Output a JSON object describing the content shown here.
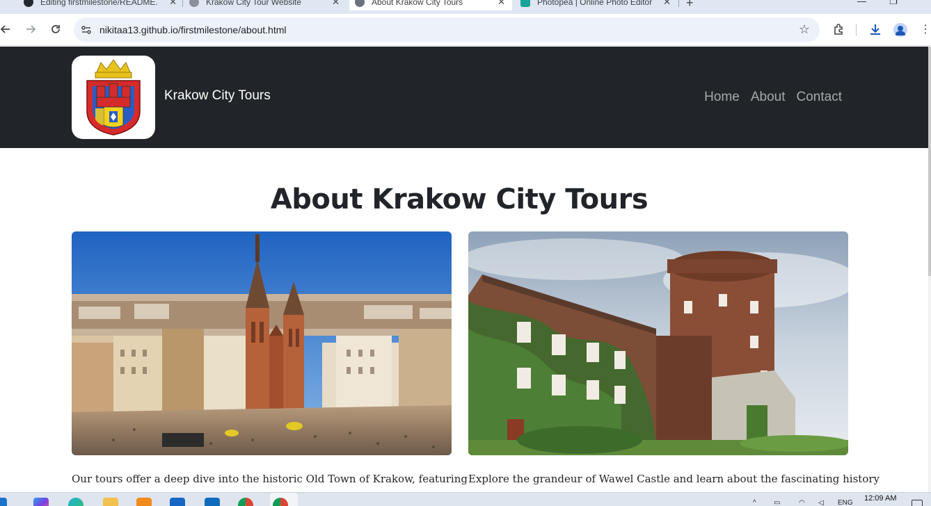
{
  "browser": {
    "tabs": [
      {
        "title": "Editing firstmilestone/README.",
        "active": false
      },
      {
        "title": "Krakow City Tour Website",
        "active": false
      },
      {
        "title": "About Krakow City Tours",
        "active": true
      },
      {
        "title": "Photopea | Online Photo Editor",
        "active": false
      }
    ],
    "new_tab_label": "+",
    "url": "nikitaa13.github.io/firstmilestone/about.html"
  },
  "site": {
    "brand": "Krakow City Tours",
    "nav": [
      {
        "label": "Home"
      },
      {
        "label": "About"
      },
      {
        "label": "Contact"
      }
    ],
    "heading": "About Krakow City Tours",
    "cards": [
      {
        "text": "Our tours offer a deep dive into the historic Old Town of Krakow, featuring"
      },
      {
        "text": "Explore the grandeur of Wawel Castle and learn about the fascinating history"
      }
    ]
  },
  "taskbar": {
    "lang": "ENG",
    "time": "12:09 AM"
  },
  "colors": {
    "navbar_bg": "#212529",
    "tab_strip_bg": "#dfe7f3",
    "omnibox_bg": "#edf2fa"
  }
}
